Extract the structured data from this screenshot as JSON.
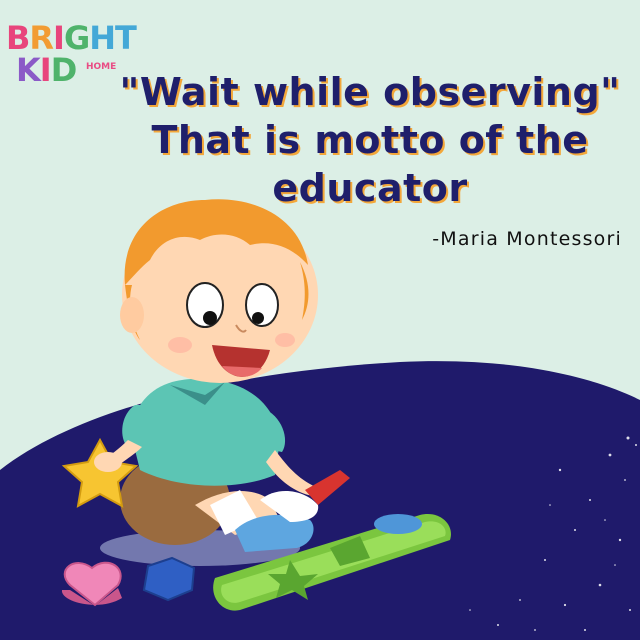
{
  "brand": {
    "line1": [
      "B",
      "R",
      "I",
      "G",
      "H",
      "T"
    ],
    "line2": [
      "K",
      "I",
      "D"
    ],
    "home": "HOME",
    "colors": [
      "#e8457c",
      "#f29c33",
      "#44a8d7",
      "#4fb36b",
      "#8b5ac7",
      "#e8457c"
    ]
  },
  "quote": {
    "line1": "\"Wait while observing\"",
    "line2": "That is motto of the",
    "line3": "educator"
  },
  "author": "-Maria Montessori",
  "colors": {
    "background": "#dcefe6",
    "ground": "#1f1a6b",
    "text": "#1f1f6b",
    "text_shadow": "#f3a73a"
  },
  "icons": [
    "star-toy-icon",
    "heart-toy-icon",
    "hexagon-toy-icon",
    "shape-sorter-board-icon",
    "child-illustration"
  ]
}
